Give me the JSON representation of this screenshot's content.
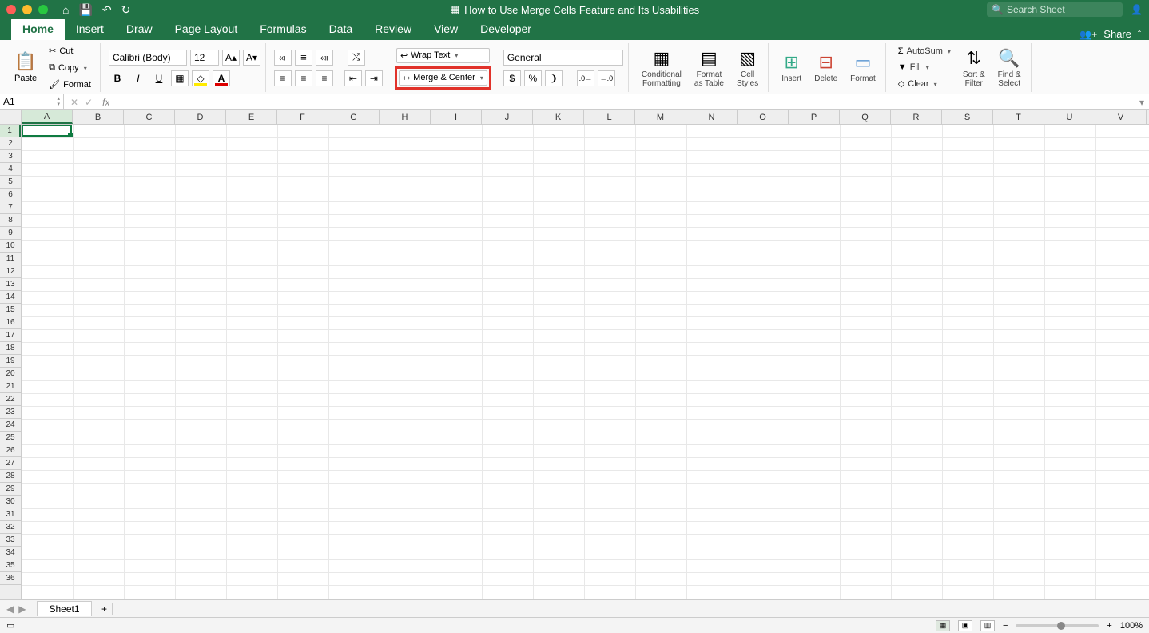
{
  "title": "How to Use Merge Cells Feature and Its Usabilities",
  "search_placeholder": "Search Sheet",
  "tabs": [
    "Home",
    "Insert",
    "Draw",
    "Page Layout",
    "Formulas",
    "Data",
    "Review",
    "View",
    "Developer"
  ],
  "active_tab": "Home",
  "share_label": "Share",
  "clipboard": {
    "paste": "Paste",
    "cut": "Cut",
    "copy": "Copy",
    "format": "Format"
  },
  "font": {
    "name": "Calibri (Body)",
    "size": "12"
  },
  "alignment": {
    "wrap": "Wrap Text",
    "merge": "Merge & Center"
  },
  "number": {
    "format": "General"
  },
  "styles": {
    "cond": "Conditional",
    "cond2": "Formatting",
    "fat": "Format",
    "fat2": "as Table",
    "cs": "Cell",
    "cs2": "Styles"
  },
  "cells": {
    "insert": "Insert",
    "delete": "Delete",
    "format": "Format"
  },
  "editing": {
    "autosum": "AutoSum",
    "fill": "Fill",
    "clear": "Clear",
    "sort": "Sort &",
    "sort2": "Filter",
    "find": "Find &",
    "find2": "Select"
  },
  "namebox": "A1",
  "columns": [
    "A",
    "B",
    "C",
    "D",
    "E",
    "F",
    "G",
    "H",
    "I",
    "J",
    "K",
    "L",
    "M",
    "N",
    "O",
    "P",
    "Q",
    "R",
    "S",
    "T",
    "U",
    "V"
  ],
  "rows": [
    "1",
    "2",
    "3",
    "4",
    "5",
    "6",
    "7",
    "8",
    "9",
    "10",
    "11",
    "12",
    "13",
    "14",
    "15",
    "16",
    "17",
    "18",
    "19",
    "20",
    "21",
    "22",
    "23",
    "24",
    "25",
    "26",
    "27",
    "28",
    "29",
    "30",
    "31",
    "32",
    "33",
    "34",
    "35",
    "36"
  ],
  "sheet_tab": "Sheet1",
  "zoom": "100%"
}
